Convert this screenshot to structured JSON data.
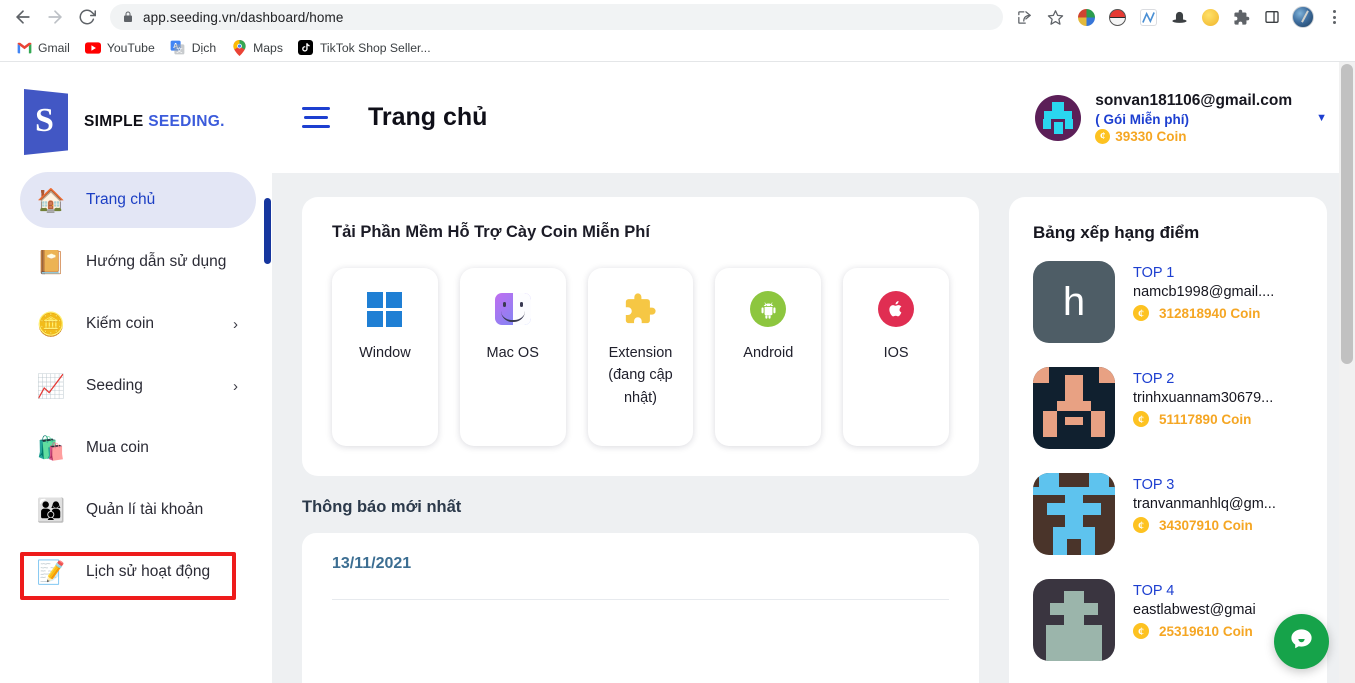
{
  "browser": {
    "url": "app.seeding.vn/dashboard/home",
    "nav": {
      "back": "back-arrow",
      "forward": "forward-arrow",
      "reload": "reload"
    },
    "toolbar_icons": [
      "share-icon",
      "bookmark-star-icon",
      "paint-extension-icon",
      "pokeball-extension-icon",
      "network-extension-icon",
      "hat-extension-icon",
      "emoji-extension-icon",
      "puzzle-extensions-icon",
      "sidepanel-icon",
      "profile-avatar",
      "menu-dots-icon"
    ],
    "bookmarks": [
      {
        "label": "Gmail",
        "icon": "gmail-icon"
      },
      {
        "label": "YouTube",
        "icon": "youtube-icon"
      },
      {
        "label": "Dịch",
        "icon": "google-translate-icon"
      },
      {
        "label": "Maps",
        "icon": "google-maps-icon"
      },
      {
        "label": "TikTok Shop Seller...",
        "icon": "tiktok-icon"
      }
    ]
  },
  "sidebar": {
    "logo": {
      "mark": "S",
      "word1": "SIMPLE",
      "word2": "SEEDING."
    },
    "items": [
      {
        "label": "Trang chủ",
        "icon": "home-icon",
        "active": true,
        "chevron": ""
      },
      {
        "label": "Hướng dẫn sử dụng",
        "icon": "book-icon",
        "active": false,
        "chevron": ""
      },
      {
        "label": "Kiếm coin",
        "icon": "coins-icon",
        "active": false,
        "chevron": "›"
      },
      {
        "label": "Seeding",
        "icon": "chart-up-icon",
        "active": false,
        "chevron": "›"
      },
      {
        "label": "Mua coin",
        "icon": "shopping-bag-icon",
        "active": false,
        "chevron": ""
      },
      {
        "label": "Quản lí tài khoản",
        "icon": "users-icon",
        "active": false,
        "chevron": ""
      },
      {
        "label": "Lịch sử hoạt động",
        "icon": "scroll-pencil-icon",
        "active": false,
        "chevron": ""
      }
    ]
  },
  "topbar": {
    "menu_icon": "hamburger-icon",
    "title": "Trang chủ",
    "account": {
      "email": "sonvan181106@gmail.com",
      "plan": "( Gói Miễn phí)",
      "coin": "39330 Coin",
      "coin_symbol": "¢",
      "caret": "▼"
    }
  },
  "download_section": {
    "title": "Tải Phần Mềm Hỗ Trợ Cày Coin Miễn Phí",
    "platforms": [
      {
        "label": "Window",
        "icon": "windows-logo-icon"
      },
      {
        "label": "Mac OS",
        "icon": "mac-finder-icon"
      },
      {
        "label": "Extension (đang cập nhật)",
        "icon": "puzzle-piece-icon"
      },
      {
        "label": "Android",
        "icon": "android-robot-icon"
      },
      {
        "label": "IOS",
        "icon": "apple-logo-icon"
      }
    ]
  },
  "notifications": {
    "title": "Thông báo mới nhất",
    "items": [
      {
        "date": "13/11/2021"
      }
    ]
  },
  "leaderboard": {
    "title": "Bảng xếp hạng điểm",
    "coin_symbol": "¢",
    "entries": [
      {
        "rank": "TOP 1",
        "email": "namcb1998@gmail....",
        "coin": "312818940 Coin",
        "avatar_bg": "#4e5d66",
        "avatar_letter": "h"
      },
      {
        "rank": "TOP 2",
        "email": "trinhxuannam30679...",
        "coin": "51117890 Coin",
        "avatar_bg": "#10202f",
        "avatar_fg": "#e8a183"
      },
      {
        "rank": "TOP 3",
        "email": "tranvanmanhlq@gm...",
        "coin": "34307910 Coin",
        "avatar_bg": "#4a342a",
        "avatar_fg": "#5ec3ee"
      },
      {
        "rank": "TOP 4",
        "email": "eastlabwest@gmai",
        "coin": "25319610 Coin",
        "avatar_bg": "#3a3540",
        "avatar_fg": "#9bb5ab"
      }
    ]
  },
  "chat": {
    "icon": "chat-bubble-icon",
    "color": "#16a34a"
  }
}
